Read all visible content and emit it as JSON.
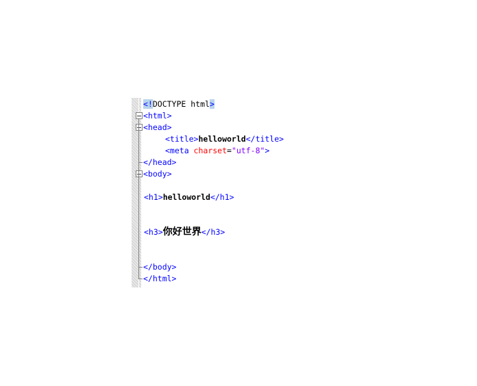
{
  "lines": {
    "doctype": {
      "open": "<!",
      "text": "DOCTYPE html",
      "close": ">"
    },
    "html_open": "<html>",
    "head_open": "<head>",
    "title": {
      "open": "<title>",
      "text": "helloworld",
      "close": "</title>"
    },
    "meta": {
      "open": "<meta ",
      "attr": "charset",
      "eq": "=",
      "value": "\"utf-8\"",
      "close": ">"
    },
    "head_close": "</head>",
    "body_open": "<body>",
    "h1": {
      "open": "<h1>",
      "text": "helloworld",
      "close": "</h1>"
    },
    "h3": {
      "open": "<h3>",
      "text": "你好世界",
      "close": "</h3>"
    },
    "body_close": "</body>",
    "html_close": "</html>"
  },
  "colors": {
    "tag": "#0000ff",
    "attribute": "#ff0000",
    "string": "#8000ff",
    "highlight": "#b8d4ec"
  },
  "icons": [
    "fold-collapse-icon",
    "fold-collapse-icon",
    "fold-collapse-icon"
  ]
}
